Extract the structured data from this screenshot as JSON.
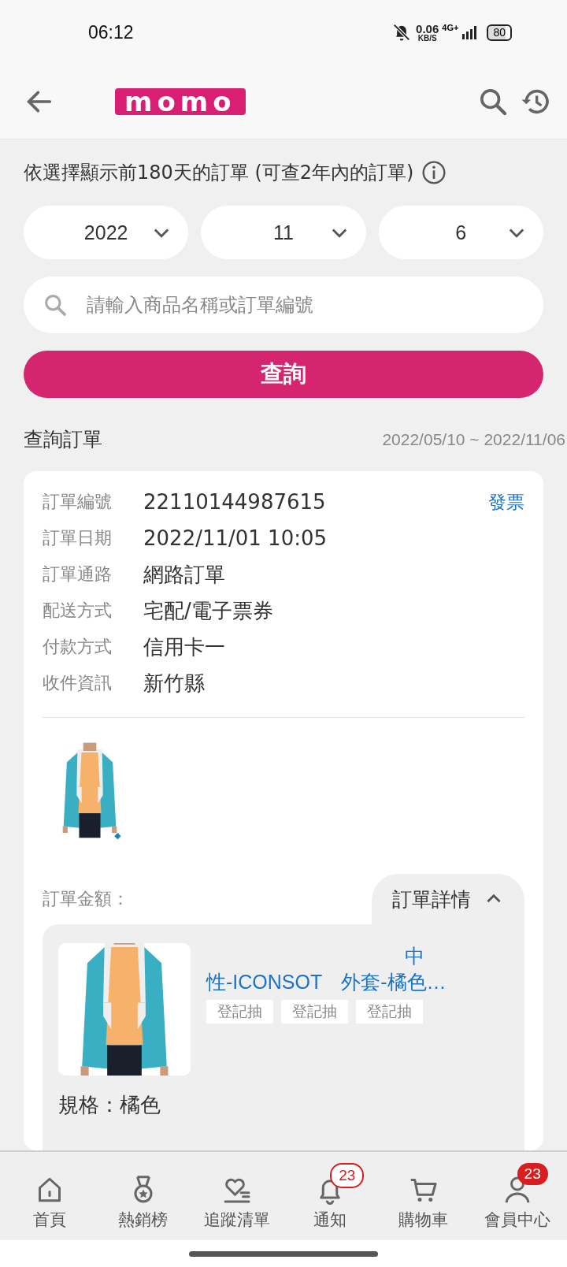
{
  "status_bar": {
    "time": "06:12",
    "net_speed": "0.06",
    "net_unit": "KB/S",
    "network": "4G+",
    "battery": "80"
  },
  "header": {
    "logo": "momo"
  },
  "notice": "依選擇顯示前180天的訂單 (可查2年內的訂單)",
  "date_selects": [
    {
      "value": "2022"
    },
    {
      "value": "11"
    },
    {
      "value": "6"
    }
  ],
  "search": {
    "placeholder": "請輸入商品名稱或訂單編號"
  },
  "query_button": "查詢",
  "section": {
    "title": "查詢訂單",
    "range": "2022/05/10 ~ 2022/11/06"
  },
  "order": {
    "invoice_link": "發票",
    "fields": [
      {
        "label": "訂單編號",
        "value": "22110144987615"
      },
      {
        "label": "訂單日期",
        "value": "2022/11/01 10:05"
      },
      {
        "label": "訂單通路",
        "value": "網路訂單"
      },
      {
        "label": "配送方式",
        "value": "宅配/電子票券"
      },
      {
        "label": "付款方式",
        "value": "信用卡一"
      },
      {
        "label": "收件資訊",
        "value": "新竹縣"
      }
    ],
    "amount_label": "訂單金額：",
    "details_toggle": {
      "label": "訂單詳情",
      "expanded": true
    },
    "item": {
      "title_line_1": "中",
      "title_line_2a": "性-ICONSOT",
      "title_line_2b": "外套-橘色…",
      "tags": [
        "登記抽",
        "登記抽",
        "登記抽"
      ],
      "spec": "規格：橘色"
    }
  },
  "bottom_nav": [
    {
      "label": "首頁"
    },
    {
      "label": "熱銷榜"
    },
    {
      "label": "追蹤清單"
    },
    {
      "label": "通知",
      "badge": {
        "text": "23",
        "kind": "outline"
      }
    },
    {
      "label": "購物車"
    },
    {
      "label": "會員中心",
      "badge": {
        "text": "23",
        "kind": "filled"
      }
    }
  ]
}
